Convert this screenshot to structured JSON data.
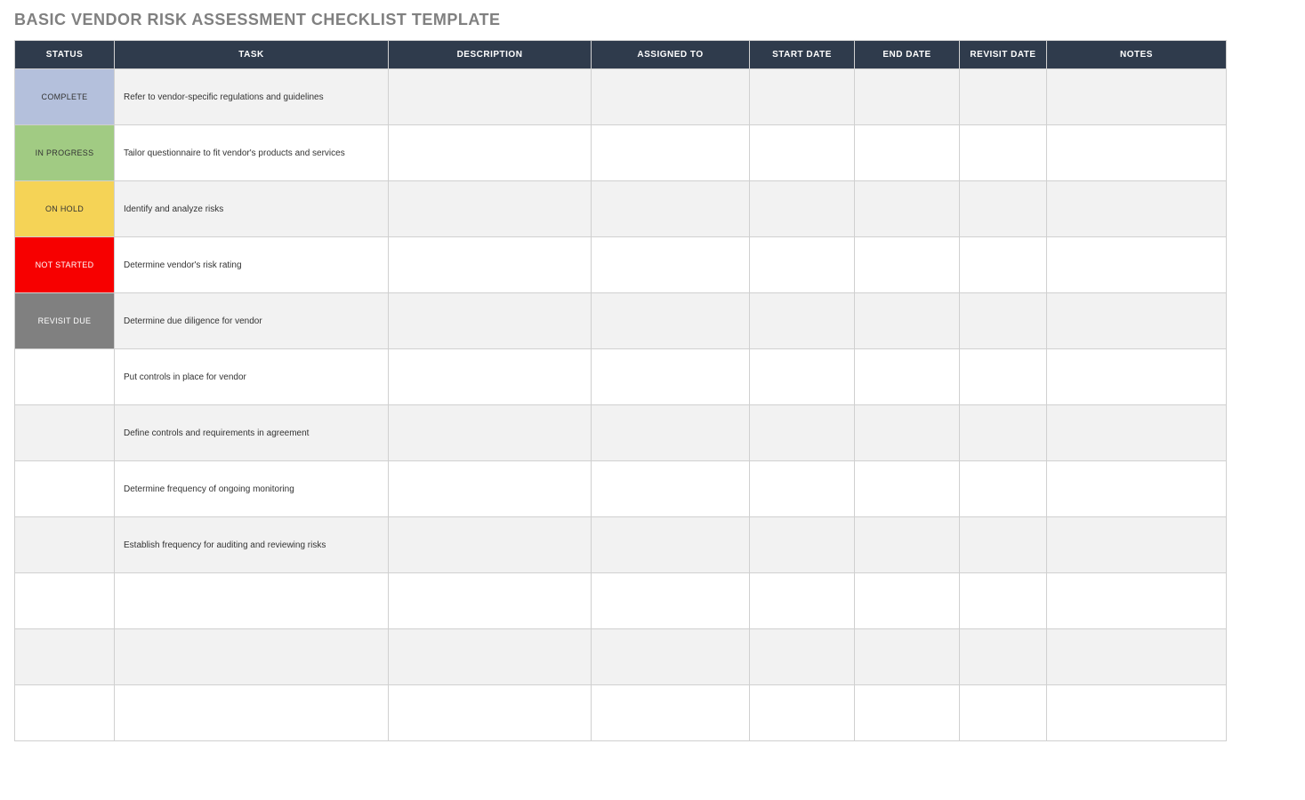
{
  "title": "BASIC VENDOR RISK ASSESSMENT CHECKLIST TEMPLATE",
  "headers": {
    "status": "STATUS",
    "task": "TASK",
    "description": "DESCRIPTION",
    "assigned_to": "ASSIGNED TO",
    "start_date": "START DATE",
    "end_date": "END DATE",
    "revisit_date": "REVISIT DATE",
    "notes": "NOTES"
  },
  "status_colors": {
    "COMPLETE": "#b4c0dc",
    "IN PROGRESS": "#a1cb83",
    "ON HOLD": "#f5d356",
    "NOT STARTED": "#f70000",
    "REVISIT DUE": "#808080"
  },
  "rows": [
    {
      "status": "COMPLETE",
      "status_class": "status-complete",
      "task": "Refer to vendor-specific regulations and guidelines",
      "description": "",
      "assigned_to": "",
      "start_date": "",
      "end_date": "",
      "revisit_date": "",
      "notes": ""
    },
    {
      "status": "IN PROGRESS",
      "status_class": "status-inprogress",
      "task": "Tailor questionnaire to fit vendor's products and services",
      "description": "",
      "assigned_to": "",
      "start_date": "",
      "end_date": "",
      "revisit_date": "",
      "notes": ""
    },
    {
      "status": "ON HOLD",
      "status_class": "status-onhold",
      "task": "Identify and analyze risks",
      "description": "",
      "assigned_to": "",
      "start_date": "",
      "end_date": "",
      "revisit_date": "",
      "notes": ""
    },
    {
      "status": "NOT STARTED",
      "status_class": "status-notstarted",
      "task": "Determine vendor's risk rating",
      "description": "",
      "assigned_to": "",
      "start_date": "",
      "end_date": "",
      "revisit_date": "",
      "notes": ""
    },
    {
      "status": "REVISIT DUE",
      "status_class": "status-revisitdue",
      "task": "Determine due diligence for vendor",
      "description": "",
      "assigned_to": "",
      "start_date": "",
      "end_date": "",
      "revisit_date": "",
      "notes": ""
    },
    {
      "status": "",
      "status_class": "",
      "task": "Put controls in place for vendor",
      "description": "",
      "assigned_to": "",
      "start_date": "",
      "end_date": "",
      "revisit_date": "",
      "notes": ""
    },
    {
      "status": "",
      "status_class": "",
      "task": "Define controls and requirements in agreement",
      "description": "",
      "assigned_to": "",
      "start_date": "",
      "end_date": "",
      "revisit_date": "",
      "notes": ""
    },
    {
      "status": "",
      "status_class": "",
      "task": "Determine frequency of ongoing monitoring",
      "description": "",
      "assigned_to": "",
      "start_date": "",
      "end_date": "",
      "revisit_date": "",
      "notes": ""
    },
    {
      "status": "",
      "status_class": "",
      "task": "Establish frequency for auditing and reviewing risks",
      "description": "",
      "assigned_to": "",
      "start_date": "",
      "end_date": "",
      "revisit_date": "",
      "notes": ""
    },
    {
      "status": "",
      "status_class": "",
      "task": "",
      "description": "",
      "assigned_to": "",
      "start_date": "",
      "end_date": "",
      "revisit_date": "",
      "notes": ""
    },
    {
      "status": "",
      "status_class": "",
      "task": "",
      "description": "",
      "assigned_to": "",
      "start_date": "",
      "end_date": "",
      "revisit_date": "",
      "notes": ""
    },
    {
      "status": "",
      "status_class": "",
      "task": "",
      "description": "",
      "assigned_to": "",
      "start_date": "",
      "end_date": "",
      "revisit_date": "",
      "notes": ""
    }
  ]
}
